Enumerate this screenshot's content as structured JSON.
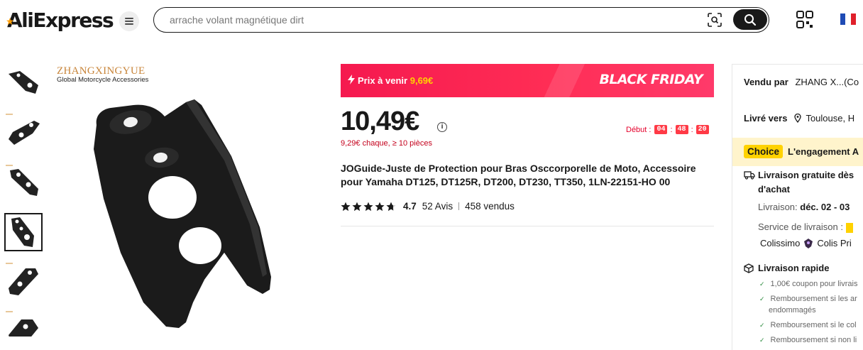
{
  "header": {
    "logo": "AliExpress",
    "search_placeholder": "arrache volant magnétique dirt"
  },
  "gallery": {
    "thumbnail_count": 6,
    "selected_index": 3,
    "brand_line1": "ZHANGXINGYUE",
    "brand_line2": "Global Motorcycle Accessories"
  },
  "banner": {
    "prix_label": "Prix à venir",
    "prix_amount": "9,69€",
    "event": "BLACK FRIDAY"
  },
  "product": {
    "price": "10,49€",
    "bulk_price": "9,29€ chaque, ≥ 10 pièces",
    "countdown_label": "Début :",
    "countdown_h": "04",
    "countdown_m": "48",
    "countdown_s": "20",
    "title": "JOGuide-Juste de Protection pour Bras Osccorporelle de Moto, Accessoire pour Yamaha DT125, DT125R, DT200, DT230, TT350, 1LN-22151-HO 00",
    "rating": "4.7",
    "reviews": "52 Avis",
    "sold": "458 vendus"
  },
  "side": {
    "sold_by_label": "Vendu par",
    "sold_by_value": "ZHANG X...(Co",
    "ship_to_label": "Livré vers",
    "ship_to_value": "Toulouse, H",
    "choice_tag": "Choice",
    "choice_text": "L'engagement A",
    "free_delivery_1": "Livraison gratuite dès",
    "free_delivery_2": "d'achat",
    "delivery_label": "Livraison:",
    "delivery_value": "déc. 02 - 03",
    "service_label": "Service de livraison :",
    "carrier_1": "Colissimo",
    "carrier_2": "Colis Pri",
    "fast_delivery": "Livraison rapide",
    "perks": [
      "1,00€ coupon pour livrais",
      "Remboursement si les ar",
      "endommagés",
      "Remboursement si le col",
      "Remboursement si non li"
    ]
  }
}
